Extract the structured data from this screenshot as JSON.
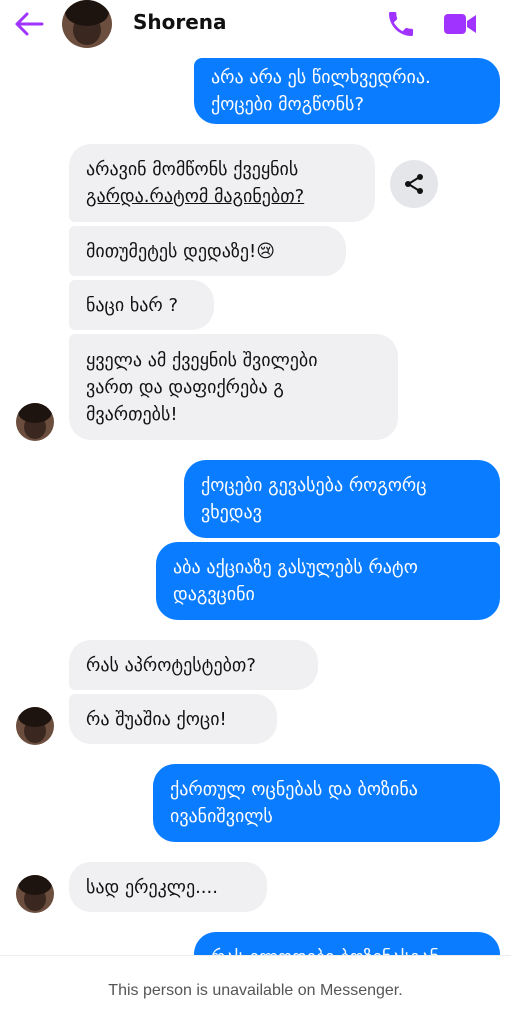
{
  "header": {
    "contact_name": "Shorena",
    "icons": {
      "back": "back-arrow-icon",
      "call": "phone-icon",
      "video": "video-camera-icon"
    },
    "accent_color": "#a033ff"
  },
  "messages": [
    {
      "from": "me",
      "lines": [
        "არა არა ეს წილხვედრია.",
        "ქოცები მოგწონს?"
      ]
    },
    {
      "from": "them",
      "lines": [
        "არავინ მომწონს ქვეყნის",
        "გარდა.რატომ მაგინებთ?"
      ]
    },
    {
      "from": "them",
      "lines": [
        "მითუმეტეს დედაზე!😢"
      ]
    },
    {
      "from": "them",
      "lines": [
        "ნაცი ხარ ?"
      ]
    },
    {
      "from": "them",
      "lines": [
        "ყველა ამ ქვეყნის შვილები",
        "ვართ  და დაფიქრება გ",
        "მვართებს!"
      ]
    },
    {
      "from": "me",
      "lines": [
        "ქოცები გევასება როგორც",
        "ვხედავ"
      ]
    },
    {
      "from": "me",
      "lines": [
        "აბა აქციაზე გასულებს რატო",
        "დაგვცინი"
      ]
    },
    {
      "from": "them",
      "lines": [
        "რას აპროტესტებთ?"
      ]
    },
    {
      "from": "them",
      "lines": [
        "რა შუაშია ქოცი!"
      ]
    },
    {
      "from": "me",
      "lines": [
        "ქართულ ოცნებას და ბოზინა",
        "ივანიშვილს"
      ]
    },
    {
      "from": "them",
      "lines": [
        "სად  ერეკლე...."
      ]
    },
    {
      "from": "me",
      "lines": [
        "რას ელოდები ბოზინასგან"
      ]
    }
  ],
  "share_icon": "share-icon",
  "colors": {
    "outgoing": "#0a7cff",
    "incoming": "#f0f0f2"
  },
  "footer": {
    "notice": "This person is unavailable on Messenger."
  }
}
